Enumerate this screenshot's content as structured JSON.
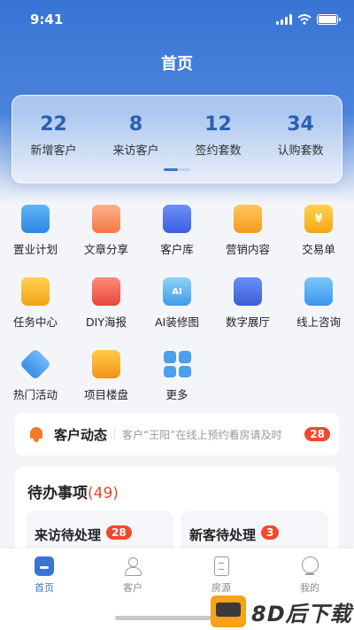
{
  "status": {
    "time": "9:41"
  },
  "header": {
    "title": "首页"
  },
  "stats": [
    {
      "value": "22",
      "label": "新增客户"
    },
    {
      "value": "8",
      "label": "来访客户"
    },
    {
      "value": "12",
      "label": "签约套数"
    },
    {
      "value": "34",
      "label": "认购套数"
    }
  ],
  "grid": [
    {
      "label": "置业计划",
      "icon": "plan-icon"
    },
    {
      "label": "文章分享",
      "icon": "article-icon"
    },
    {
      "label": "客户库",
      "icon": "customer-library-icon"
    },
    {
      "label": "营销内容",
      "icon": "marketing-icon"
    },
    {
      "label": "交易单",
      "icon": "yen-icon",
      "glyph": "¥"
    },
    {
      "label": "任务中心",
      "icon": "task-icon"
    },
    {
      "label": "DIY海报",
      "icon": "poster-icon"
    },
    {
      "label": "AI装修图",
      "icon": "ai-image-icon",
      "glyph": "AI"
    },
    {
      "label": "数字展厅",
      "icon": "hall-icon"
    },
    {
      "label": "线上咨询",
      "icon": "chat-icon"
    },
    {
      "label": "热门活动",
      "icon": "tag-icon"
    },
    {
      "label": "项目楼盘",
      "icon": "building-icon"
    },
    {
      "label": "更多",
      "icon": "more-icon"
    }
  ],
  "news": {
    "title": "客户动态",
    "text": "客户“王阳”在线上预约看房请及时",
    "count": "28"
  },
  "todo": {
    "title": "待办事项",
    "count": "(49)",
    "cards": [
      {
        "title": "来访待处理",
        "count": "28"
      },
      {
        "title": "新客待处理",
        "count": "3"
      }
    ]
  },
  "tabbar": [
    {
      "label": "首页",
      "active": true
    },
    {
      "label": "客户"
    },
    {
      "label": "房源"
    },
    {
      "label": "我的"
    }
  ],
  "watermark": {
    "text": "8D后下载"
  },
  "colors": {
    "primary": "#3a74d4",
    "badge": "#f0492d"
  }
}
